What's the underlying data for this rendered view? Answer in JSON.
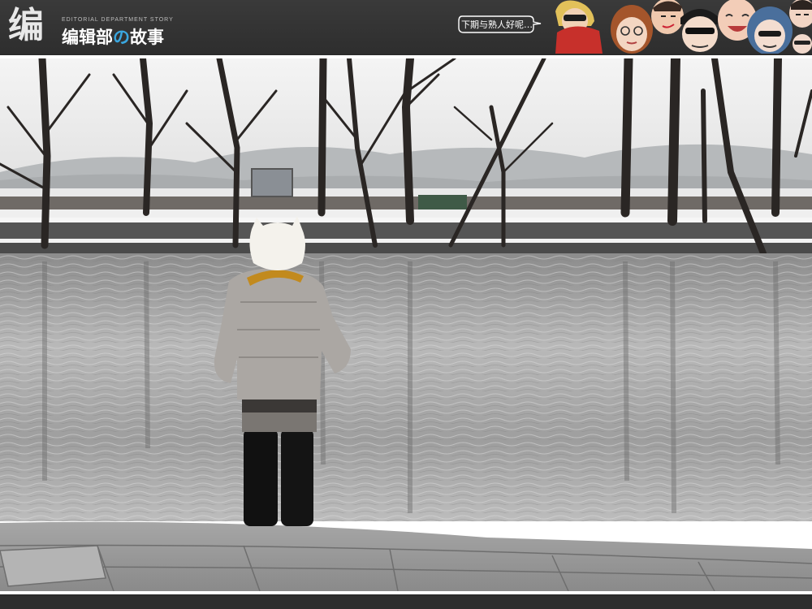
{
  "header": {
    "logo_mark": "编",
    "logo_subtitle": "EDITORIAL DEPARTMENT STORY",
    "logo_title_1": "编辑部",
    "logo_title_accent": "の",
    "logo_title_2": "故事",
    "speech_text": "下期与熟人好呢…"
  },
  "icons": {
    "cast_portraits": "cartoon-cast-portraits",
    "speech_bubble": "speech-bubble-icon"
  }
}
